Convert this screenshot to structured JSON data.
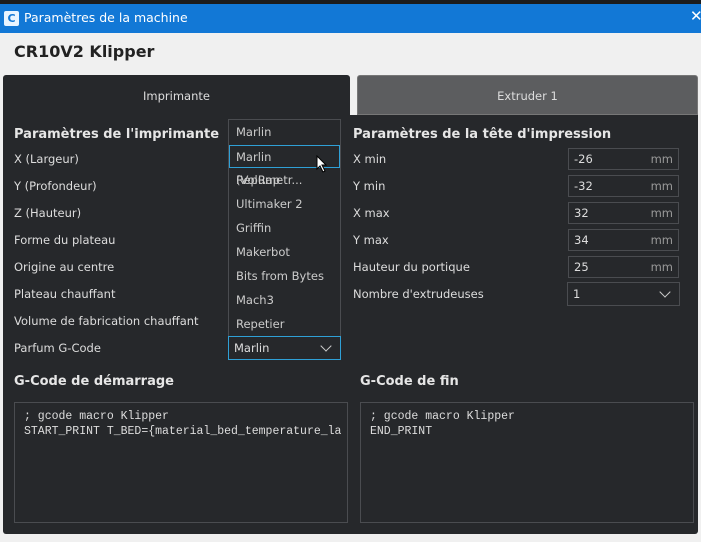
{
  "window": {
    "title": "Paramètres de la machine",
    "logo": "C"
  },
  "machine_name": "CR10V2 Klipper",
  "tabs": [
    {
      "label": "Imprimante"
    },
    {
      "label": "Extruder 1"
    }
  ],
  "printer": {
    "title": "Paramètres de l'imprimante",
    "labels": [
      "X (Largeur)",
      "Y (Profondeur)",
      "Z (Hauteur)",
      "Forme du plateau",
      "Origine au centre",
      "Plateau chauffant",
      "Volume de fabrication chauffant",
      "Parfum G-Code"
    ],
    "gcode_flavor": "Marlin",
    "flavor_options": [
      "Marlin",
      "Marlin (Volumetr...",
      "RepRap",
      "Ultimaker 2",
      "Griffin",
      "Makerbot",
      "Bits from Bytes",
      "Mach3",
      "Repetier"
    ]
  },
  "head": {
    "title": "Paramètres de la tête d'impression",
    "fields": [
      {
        "label": "X min",
        "value": "-26",
        "unit": "mm"
      },
      {
        "label": "Y min",
        "value": "-32",
        "unit": "mm"
      },
      {
        "label": "X max",
        "value": "32",
        "unit": "mm"
      },
      {
        "label": "Y max",
        "value": "34",
        "unit": "mm"
      },
      {
        "label": "Hauteur du portique",
        "value": "25",
        "unit": "mm"
      }
    ],
    "extruders_label": "Nombre d'extrudeuses",
    "extruders_value": "1"
  },
  "start_gcode": {
    "title": "G-Code de démarrage",
    "text": "; gcode macro Klipper\nSTART_PRINT T_BED={material_bed_temperature_la"
  },
  "end_gcode": {
    "title": "G-Code de fin",
    "text": "; gcode macro Klipper\nEND_PRINT"
  }
}
